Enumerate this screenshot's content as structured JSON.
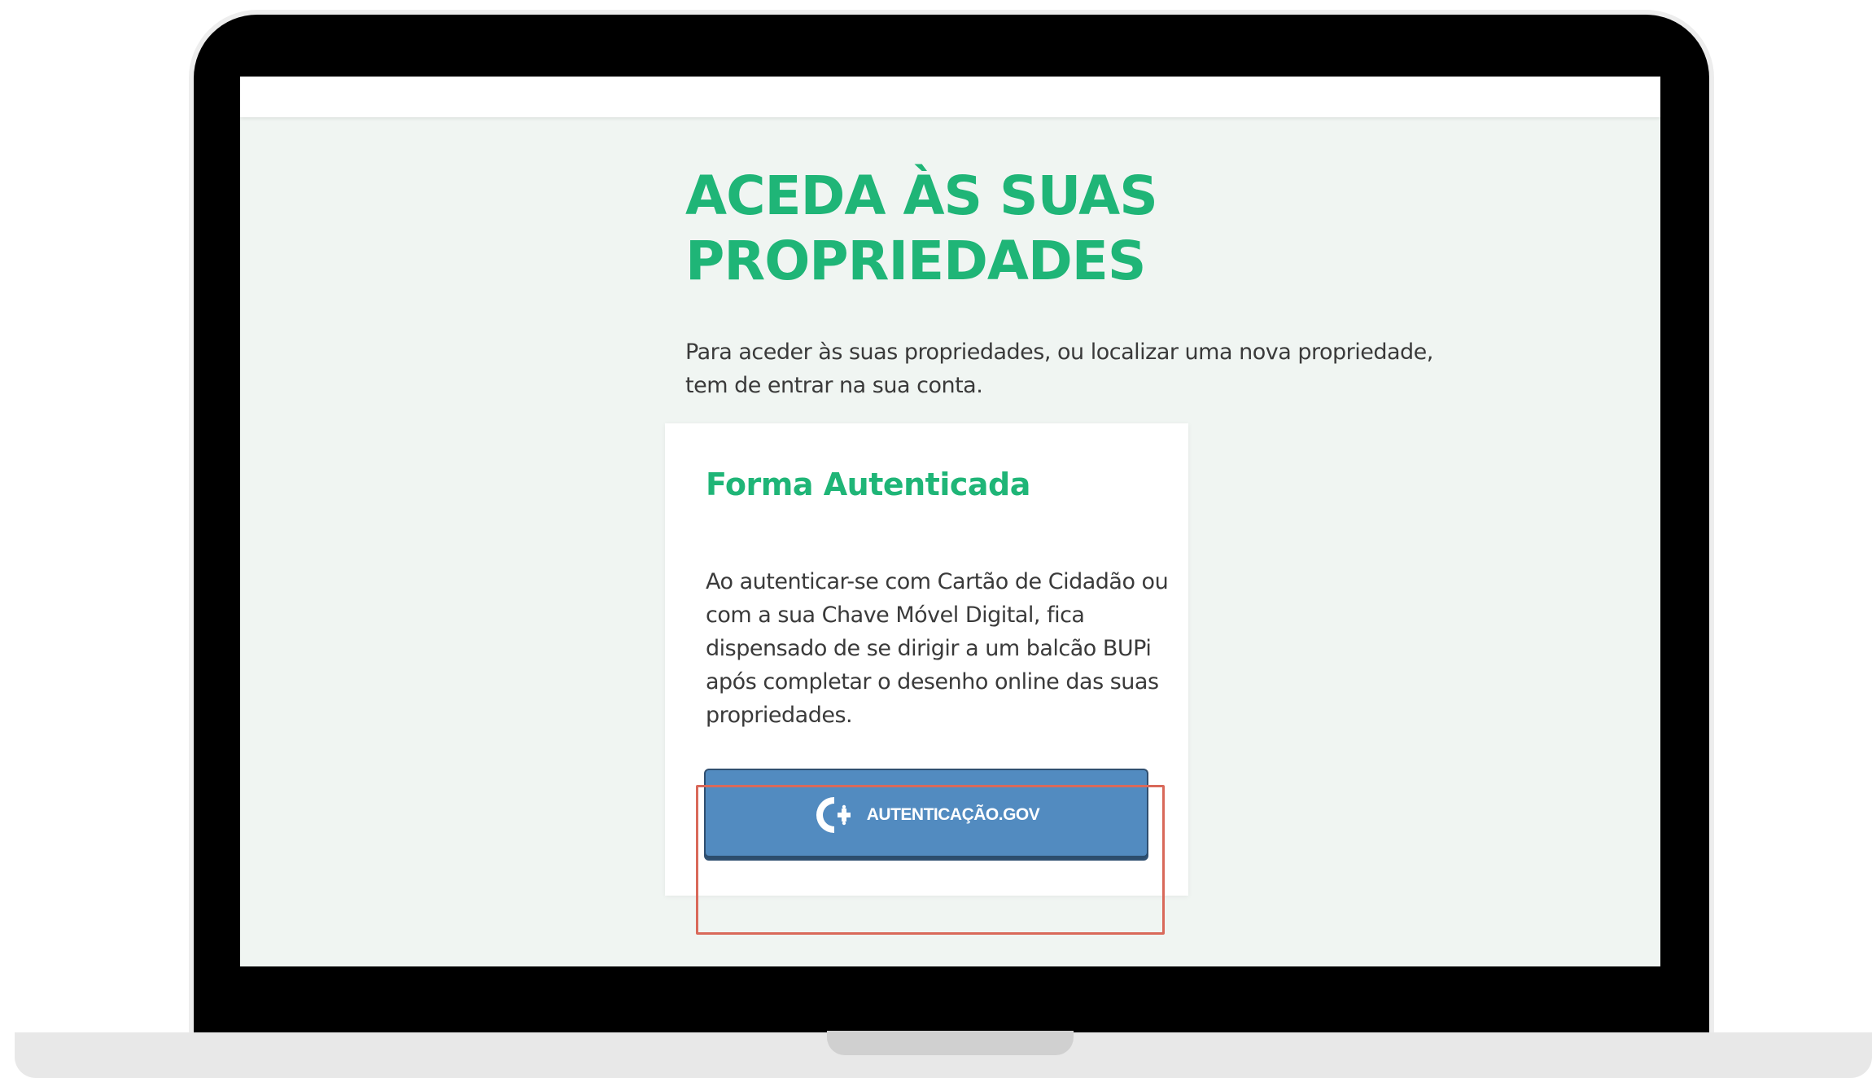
{
  "page": {
    "title": "ACEDA ÀS SUAS PROPRIEDADES",
    "intro": "Para aceder às suas propriedades, ou localizar uma nova propriedade, tem de entrar na sua conta."
  },
  "card": {
    "title": "Forma Autenticada",
    "body": "Ao autenticar-se com Cartão de Cidadão ou com a sua Chave Móvel Digital, fica dispensado de se dirigir a um balcão BUPi após completar o desenho online das suas propriedades.",
    "button": {
      "label": "AUTENTICAÇÃO.GOV",
      "icon": "autenticacao-gov-logo-icon"
    }
  },
  "colors": {
    "accent_green": "#1fb577",
    "button_blue": "#528bc0",
    "page_background": "#f0f5f2",
    "highlight_red": "#d9695a"
  }
}
